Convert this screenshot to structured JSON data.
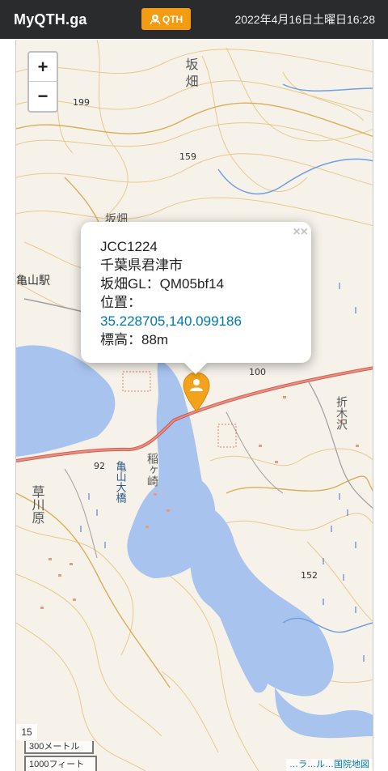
{
  "header": {
    "brand": "MyQTH.ga",
    "qth_button": "QTH",
    "datetime": "2022年4月16日土曜日16:28"
  },
  "map": {
    "zoom_in": "+",
    "zoom_out": "−",
    "zoom_level": "15",
    "scale_metric": "300メートル",
    "scale_imperial": "1000フィート",
    "attribution": "…ラ…ル…国院地図",
    "place_labels": {
      "sakahata_top": "坂 畑",
      "sakahata_mid": "坂畑",
      "kameyama_station": "亀山駅",
      "kusagawahara": "草川原",
      "kameyama_bridge": "亀山大橋",
      "inagasaki": "稲ヶ崎",
      "orikisawa": "折木沢"
    },
    "elevations": [
      "199",
      "159",
      "100",
      "92",
      "152"
    ],
    "water_color": "#a8c4ee",
    "road_color": "#e07a6f",
    "contour_color": "#e7c98a"
  },
  "popup": {
    "close": "××",
    "code": "JCC1224",
    "city": "千葉県君津市",
    "grid": "坂畑GL：QM05bf14",
    "position_label": "位置：",
    "coordinates": "35.228705,140.099186",
    "altitude": "標高：88m"
  },
  "colors": {
    "topbar": "#2a2b2d",
    "accent": "#f39c12",
    "link": "#0078a8"
  }
}
